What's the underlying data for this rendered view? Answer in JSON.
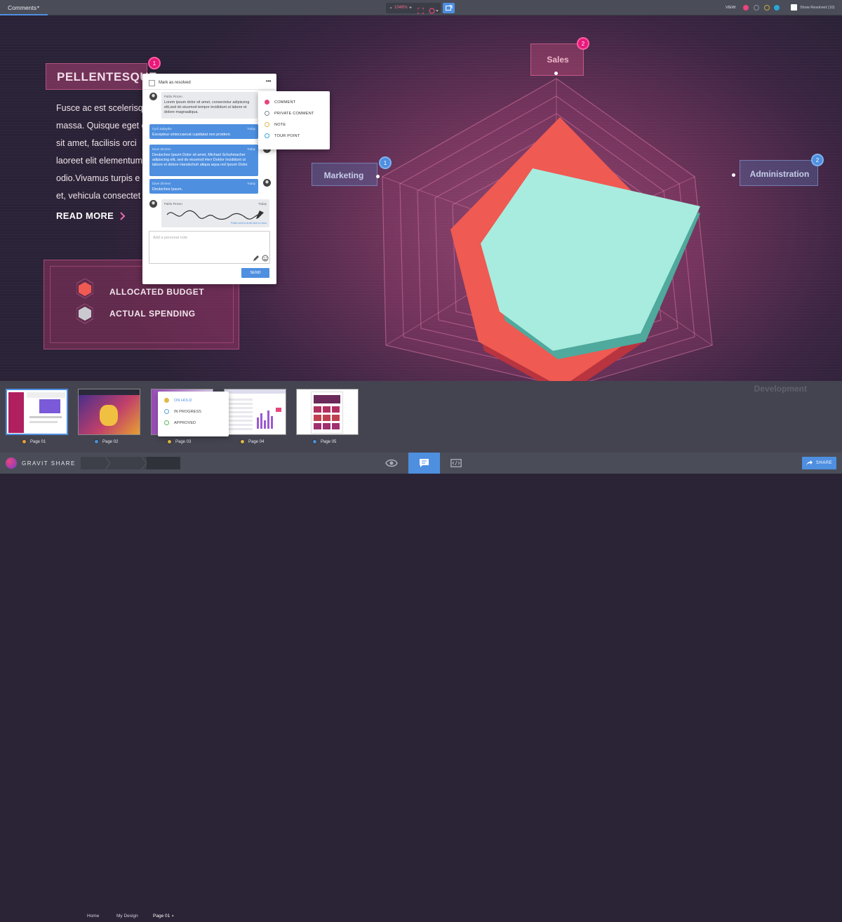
{
  "topbar": {
    "mode_label": "Comments",
    "mode_caret": "▾",
    "zoom_minus": "-",
    "zoom_value": "1048%",
    "zoom_plus": "+",
    "view_label": "VIEW:",
    "view_colors": [
      "#e8457a",
      "#5e6070",
      "#c9a640",
      "#2aa6d8"
    ],
    "show_resolved": "Show Resolved (10)"
  },
  "slide": {
    "heading": "PELLENTESQUE",
    "body_lines": [
      "Fusce ac est scelerisque",
      "massa. Quisque eget c",
      "sit amet, facilisis orci",
      "laoreet elit elementum",
      "odio.Vivamus turpis e",
      "et, vehicula consectet"
    ],
    "read_more": "READ MORE",
    "legend": [
      "ALLOCATED BUDGET",
      "ACTUAL SPENDING"
    ],
    "axis_labels": {
      "sales": "Sales",
      "marketing": "Marketing",
      "administration": "Administration",
      "development": "Development"
    },
    "pins": {
      "heading": "1",
      "sales": "2",
      "marketing": "1",
      "administration": "2"
    }
  },
  "comment_panel": {
    "mark_resolved": "Mark as resolved",
    "more_icon": "•••",
    "messages": [
      {
        "author": "Pablo Pinzen",
        "time": "",
        "text": "Lorem ipsum dolor sit amet, consectetur adipiscing elit,sed do eiusmod tempor incididunt ut labore et dolore magnaaliqua."
      },
      {
        "author": "Cyril Jadaythe",
        "time": "Today",
        "text": "Excepteur sintoccaecat cupidatat non proident."
      },
      {
        "author": "Dave Zimmer",
        "time": "Today",
        "text": "Deutsches Ipsum Dolor sit amet, Michael Schuhmacher adipiscing elit, sed do eiusmod Herr Doktor incididunt ut labore et dolore Handschuh aliqua aqua red Ipsum Dolor."
      },
      {
        "author": "Dave Zimmer",
        "time": "Today",
        "text": "Deutsches Ipsum."
      },
      {
        "author": "Pablo Pinzen",
        "time": "Today",
        "text": "Pablo sent a draft click to view"
      }
    ],
    "note_placeholder": "Add a personal note",
    "send": "SEND"
  },
  "type_menu": [
    {
      "label": "COMMENT",
      "color": "#e8457a",
      "filled": true
    },
    {
      "label": "PRIVATE COMMENT",
      "color": "#7d8799",
      "filled": false
    },
    {
      "label": "NOTE",
      "color": "#e0b84a",
      "filled": false
    },
    {
      "label": "TOUR POINT",
      "color": "#3aa6d8",
      "filled": false
    }
  ],
  "status_menu": [
    {
      "label": "ON HOLD",
      "color": "#e0b84a",
      "filled": true
    },
    {
      "label": "IN PROGRESS",
      "color": "#5aa0d8",
      "filled": false
    },
    {
      "label": "APPROVED",
      "color": "#5cb85c",
      "filled": false
    }
  ],
  "pages": [
    {
      "label": "Page 01",
      "color": "#e8a13a"
    },
    {
      "label": "Page 02",
      "color": "#4a90d9"
    },
    {
      "label": "Page 03",
      "color": "#e0b84a"
    },
    {
      "label": "Page 04",
      "color": "#e0b84a"
    },
    {
      "label": "Page 05",
      "color": "#4a90d9"
    }
  ],
  "bottombar": {
    "brand": "GRAVIT SHARE",
    "breadcrumb": [
      "Home",
      "My Design",
      "Page 01"
    ],
    "breadcrumb_caret": "▴",
    "share": "SHARE"
  }
}
